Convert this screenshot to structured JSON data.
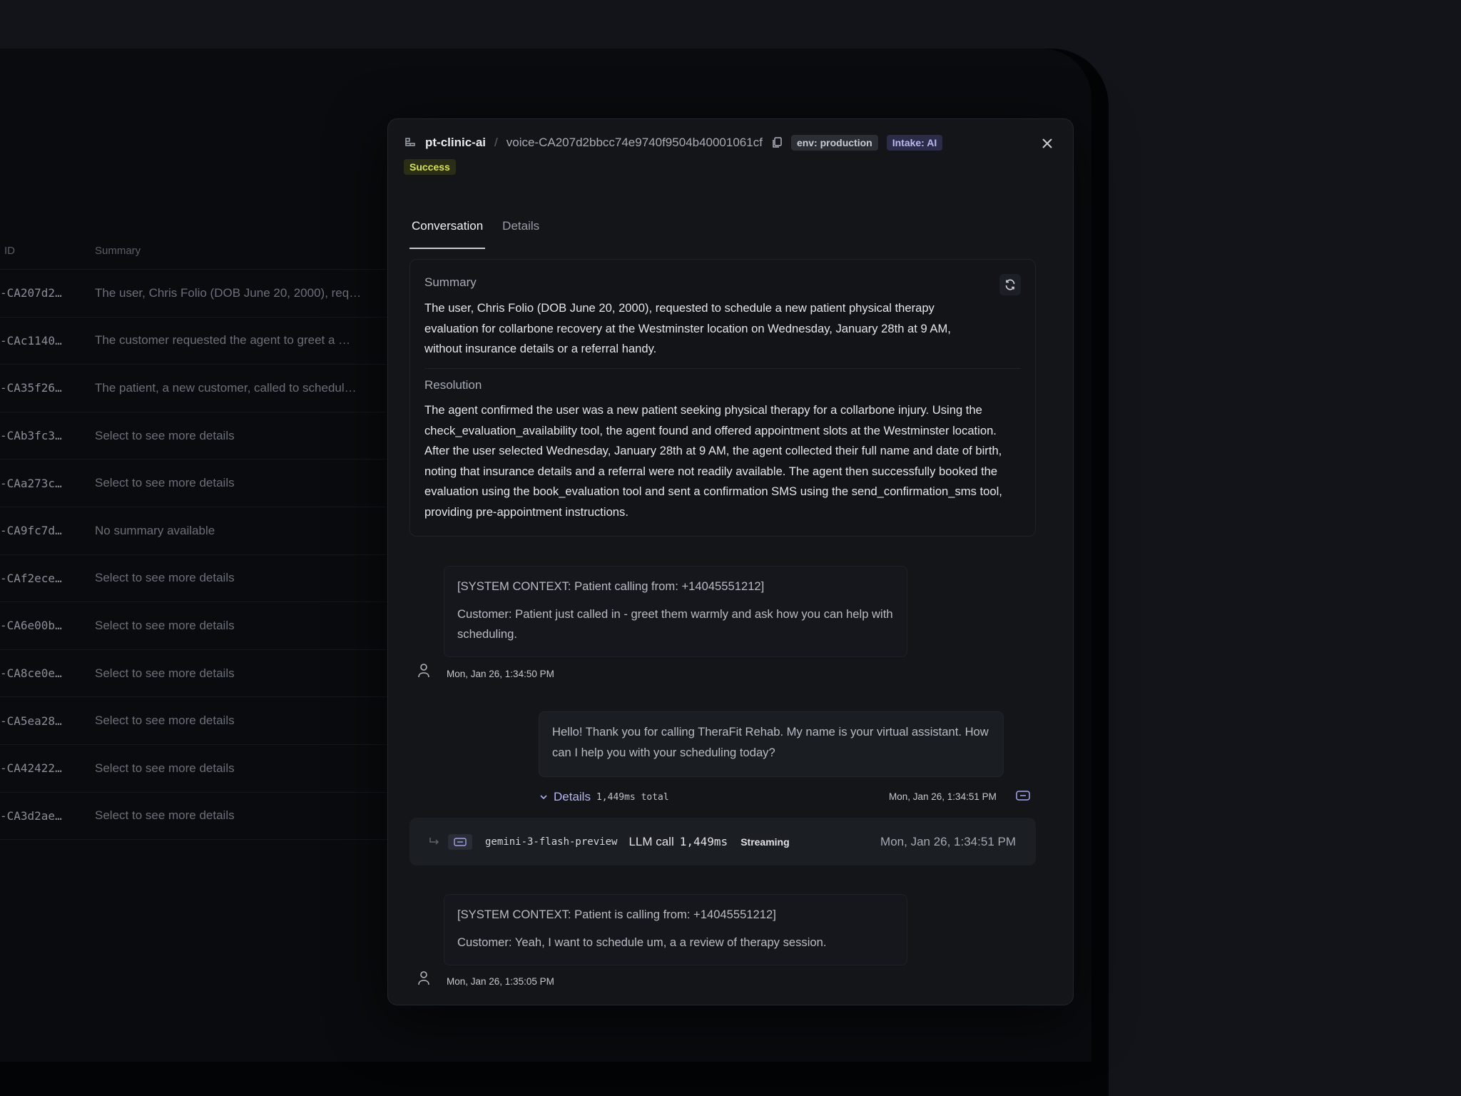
{
  "table": {
    "headers": [
      "ID",
      "Summary"
    ],
    "rows": [
      {
        "id": "-CA207d2…",
        "summary": "The user, Chris Folio (DOB June 20, 2000), req…"
      },
      {
        "id": "-CAc1140…",
        "summary": "The customer requested the agent to greet a …"
      },
      {
        "id": "-CA35f26…",
        "summary": "The patient, a new customer, called to schedul…"
      },
      {
        "id": "-CAb3fc3…",
        "summary": "Select to see more details"
      },
      {
        "id": "-CAa273c…",
        "summary": "Select to see more details"
      },
      {
        "id": "-CA9fc7d…",
        "summary": "No summary available"
      },
      {
        "id": "-CAf2ece…",
        "summary": "Select to see more details"
      },
      {
        "id": "-CA6e00b…",
        "summary": "Select to see more details"
      },
      {
        "id": "-CA8ce0e…",
        "summary": "Select to see more details"
      },
      {
        "id": "-CA5ea28…",
        "summary": "Select to see more details"
      },
      {
        "id": "-CA42422…",
        "summary": "Select to see more details"
      },
      {
        "id": "-CA3d2ae…",
        "summary": "Select to see more details"
      }
    ]
  },
  "modal": {
    "project": "pt-clinic-ai",
    "separator": "/",
    "trace_id": "voice-CA207d2bbcc74e9740f9504b40001061cf",
    "tags": {
      "env": "env: production",
      "intake": "Intake: AI"
    },
    "status": "Success",
    "tabs": [
      "Conversation",
      "Details"
    ],
    "summary_title": "Summary",
    "summary_text": "The user, Chris Folio (DOB June 20, 2000), requested to schedule a new patient physical therapy evaluation for collarbone recovery at the Westminster location on Wednesday, January 28th at 9 AM, without insurance details or a referral handy.",
    "resolution_title": "Resolution",
    "resolution_text": "The agent confirmed the user was a new patient seeking physical therapy for a collarbone injury. Using the check_evaluation_availability tool, the agent found and offered appointment slots at the Westminster location. After the user selected Wednesday, January 28th at 9 AM, the agent collected their full name and date of birth, noting that insurance details and a referral were not readily available. The agent then successfully booked the evaluation using the book_evaluation tool and sent a confirmation SMS using the send_confirmation_sms tool, providing pre-appointment instructions.",
    "messages": [
      {
        "role": "user",
        "context": "[SYSTEM CONTEXT: Patient calling from: +14045551212]",
        "text": "Customer: Patient just called in - greet them warmly and ask how you can help with scheduling.",
        "timestamp": "Mon, Jan 26, 1:34:50 PM"
      },
      {
        "role": "assistant",
        "text": "Hello! Thank you for calling TheraFit Rehab. My name is your virtual assistant. How can I help you with your scheduling today?",
        "details_label": "Details",
        "details_total": "1,449ms total",
        "timestamp": "Mon, Jan 26, 1:34:51 PM"
      },
      {
        "role": "user",
        "context": "[SYSTEM CONTEXT: Patient is calling from: +14045551212]",
        "text": "Customer: Yeah, I want to schedule um, a a review of therapy session.",
        "timestamp": "Mon, Jan 26, 1:35:05 PM"
      }
    ],
    "llm_call": {
      "model": "gemini-3-flash-preview",
      "label": "LLM call",
      "duration": "1,449ms",
      "mode": "Streaming",
      "timestamp": "Mon, Jan 26, 1:34:51 PM"
    }
  }
}
